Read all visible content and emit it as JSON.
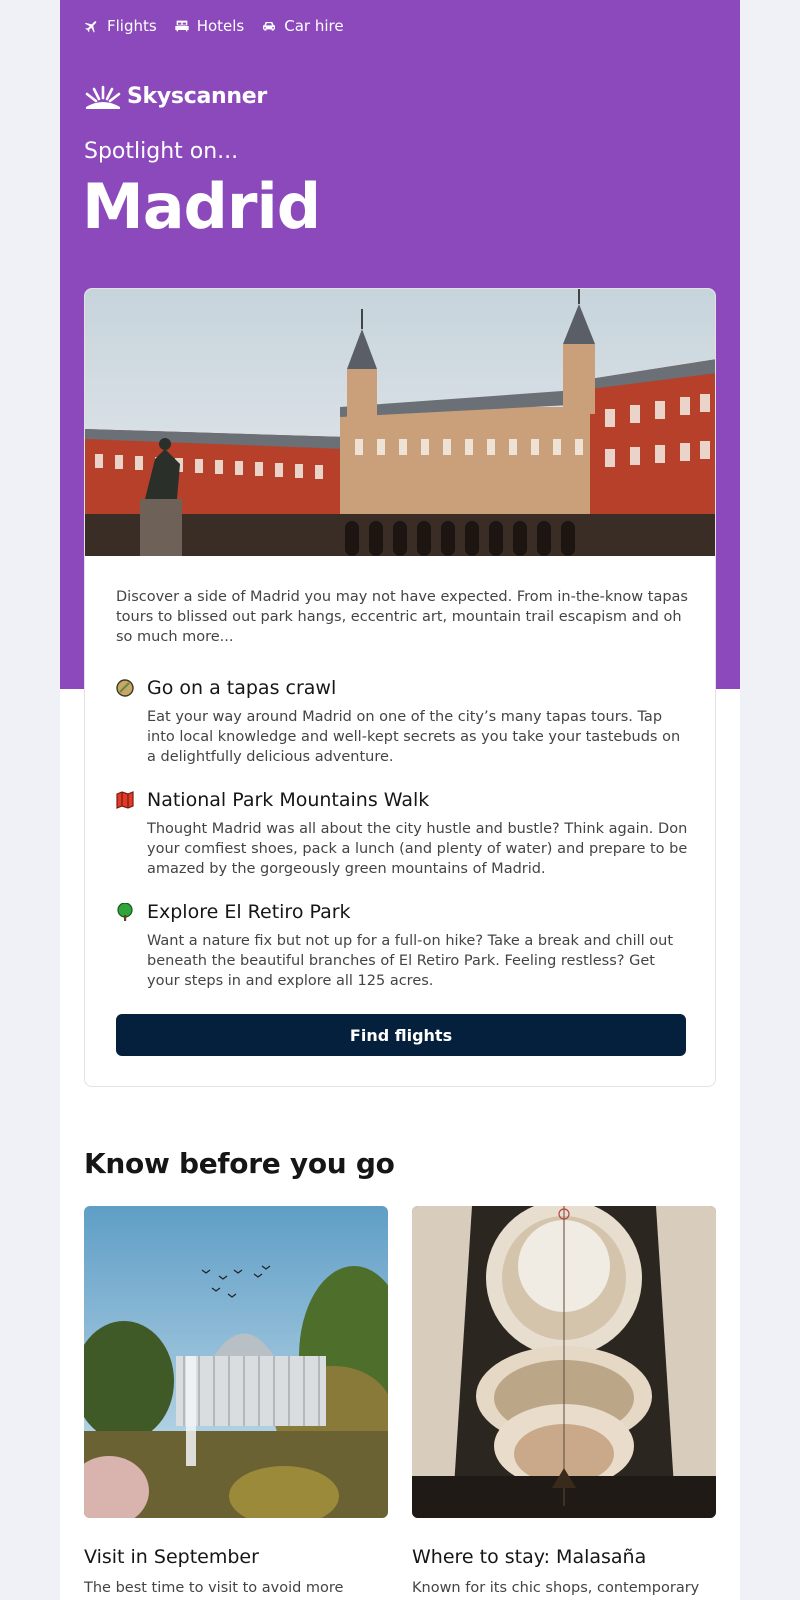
{
  "nav": {
    "items": [
      {
        "label": "Flights",
        "icon": "plane-icon"
      },
      {
        "label": "Hotels",
        "icon": "bed-icon"
      },
      {
        "label": "Car hire",
        "icon": "car-icon"
      }
    ]
  },
  "brand": {
    "name": "Skyscanner",
    "icon": "skyscanner-sunrise-logo"
  },
  "hero": {
    "kicker": "Spotlight on...",
    "city": "Madrid",
    "image_alt": "Plaza Mayor, Madrid"
  },
  "card": {
    "intro": "Discover a side of Madrid you may not have expected. From in-the-know tapas tours to blissed out park hangs, eccentric art, mountain trail escapism and oh so much more...",
    "items": [
      {
        "icon": "tapas-icon",
        "title": "Go on a tapas crawl",
        "description": "Eat your way around Madrid on one of the city’s many tapas tours. Tap into local knowledge and well-kept secrets as you take your tastebuds on a delightfully delicious adventure."
      },
      {
        "icon": "map-icon",
        "title": "National Park Mountains Walk",
        "description": "Thought Madrid was all about the city hustle and bustle? Think again. Don your comfiest shoes, pack a lunch (and plenty of water) and prepare to be amazed by the gorgeously green mountains of Madrid."
      },
      {
        "icon": "tree-icon",
        "title": "Explore El Retiro Park",
        "description": "Want a nature fix but not up for a full-on hike? Take a break and chill out beneath the beautiful branches of El Retiro Park. Feeling restless? Get your steps in and explore all 125 acres."
      }
    ],
    "cta_label": "Find flights"
  },
  "know_before": {
    "heading": "Know before you go",
    "tiles": [
      {
        "title": "Visit in September",
        "description": "The best time to visit to avoid more"
      },
      {
        "title": "Where to stay: Malasaña",
        "description": "Known for its chic shops, contemporary"
      }
    ]
  },
  "colors": {
    "brand_purple": "#8c49bb",
    "cta_navy": "#05203c"
  }
}
